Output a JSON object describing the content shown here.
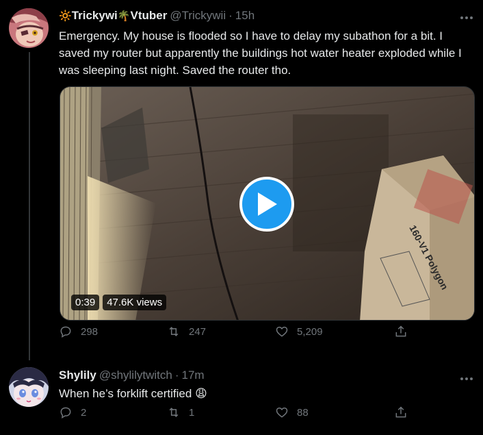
{
  "tweet1": {
    "display_name_prefix": "🔆",
    "display_name_a": "Trickywi",
    "display_name_emoji": "🌴",
    "display_name_b": "Vtuber",
    "handle": "@Trickywii",
    "separator": "·",
    "time": "15h",
    "text": "Emergency. My house is flooded so I have to delay my subathon for a bit. I saved my router but apparently the buildings hot water heater exploded while I was sleeping last night. Saved the router tho.",
    "video": {
      "duration": "0:39",
      "views": "47.6K views",
      "box_text": "160-V1 Polygon"
    },
    "actions": {
      "replies": "298",
      "retweets": "247",
      "likes": "5,209"
    }
  },
  "tweet2": {
    "display_name": "Shylily",
    "handle": "@shylilytwitch",
    "separator": "·",
    "time": "17m",
    "text": "When he’s forklift certified",
    "text_emoji": "😩",
    "actions": {
      "replies": "2",
      "retweets": "1",
      "likes": "88"
    }
  },
  "colors": {
    "background": "#000000",
    "text": "#e7e9ea",
    "muted": "#71767b",
    "accent": "#1d9bf0",
    "thread_line": "#333639"
  },
  "icons": [
    "reply-icon",
    "retweet-icon",
    "like-icon",
    "share-icon",
    "more-icon",
    "play-icon"
  ]
}
